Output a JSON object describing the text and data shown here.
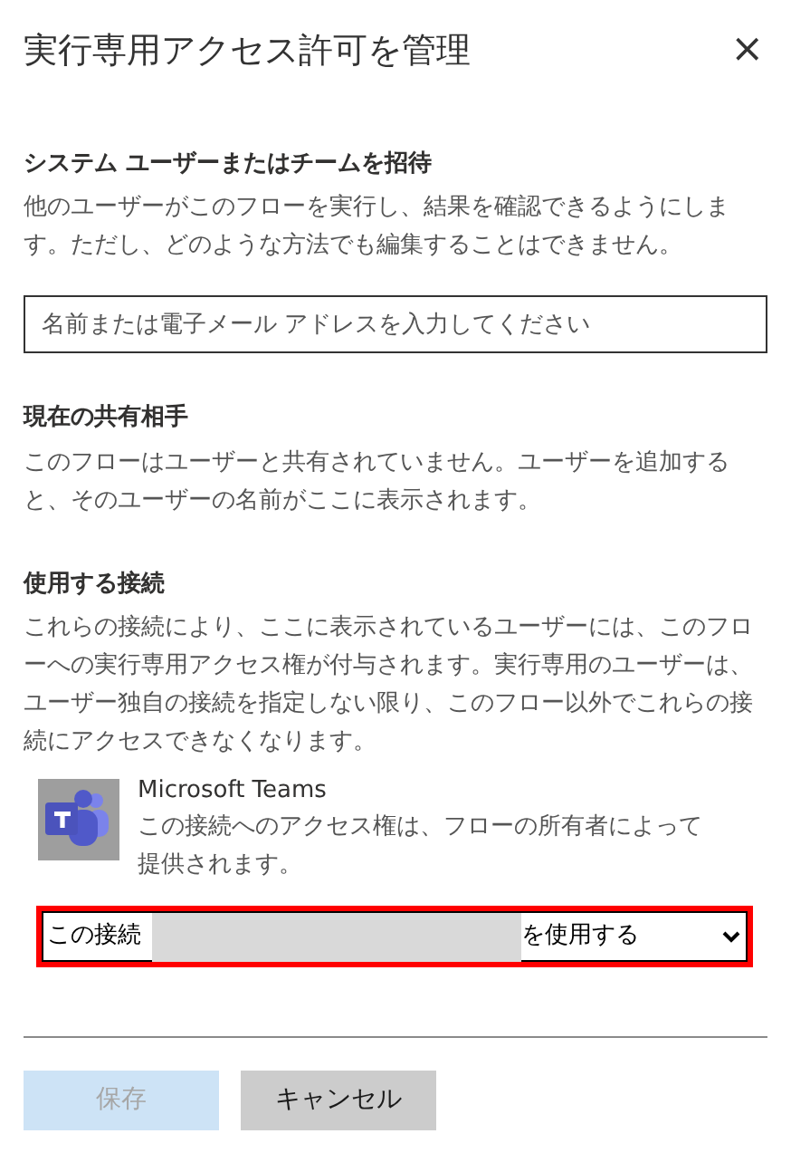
{
  "dialog": {
    "title": "実行専用アクセス許可を管理",
    "close": "×"
  },
  "invite": {
    "heading": "システム ユーザーまたはチームを招待",
    "description": "他のユーザーがこのフローを実行し、結果を確認できるようにします。ただし、どのような方法でも編集することはできません。",
    "placeholder": "名前または電子メール アドレスを入力してください"
  },
  "shared": {
    "heading": "現在の共有相手",
    "description": "このフローはユーザーと共有されていません。ユーザーを追加すると、そのユーザーの名前がここに表示されます。"
  },
  "connections": {
    "heading": "使用する接続",
    "description": "これらの接続により、ここに表示されているユーザーには、このフローへの実行専用アクセス権が付与されます。実行専用のユーザーは、ユーザー独自の接続を指定しない限り、このフロー以外でこれらの接続にアクセスできなくなります。",
    "items": [
      {
        "name": "Microsoft Teams",
        "note": "この接続へのアクセス権は、フローの所有者によって提供されます。",
        "choice_start": "この接続",
        "choice_end": "を使用する",
        "redacted": true,
        "highlighted": true
      }
    ]
  },
  "buttons": [
    {
      "label": "保存",
      "kind": "primary",
      "disabled": true
    },
    {
      "label": "キャンセル",
      "kind": "secondary",
      "disabled": false
    }
  ]
}
